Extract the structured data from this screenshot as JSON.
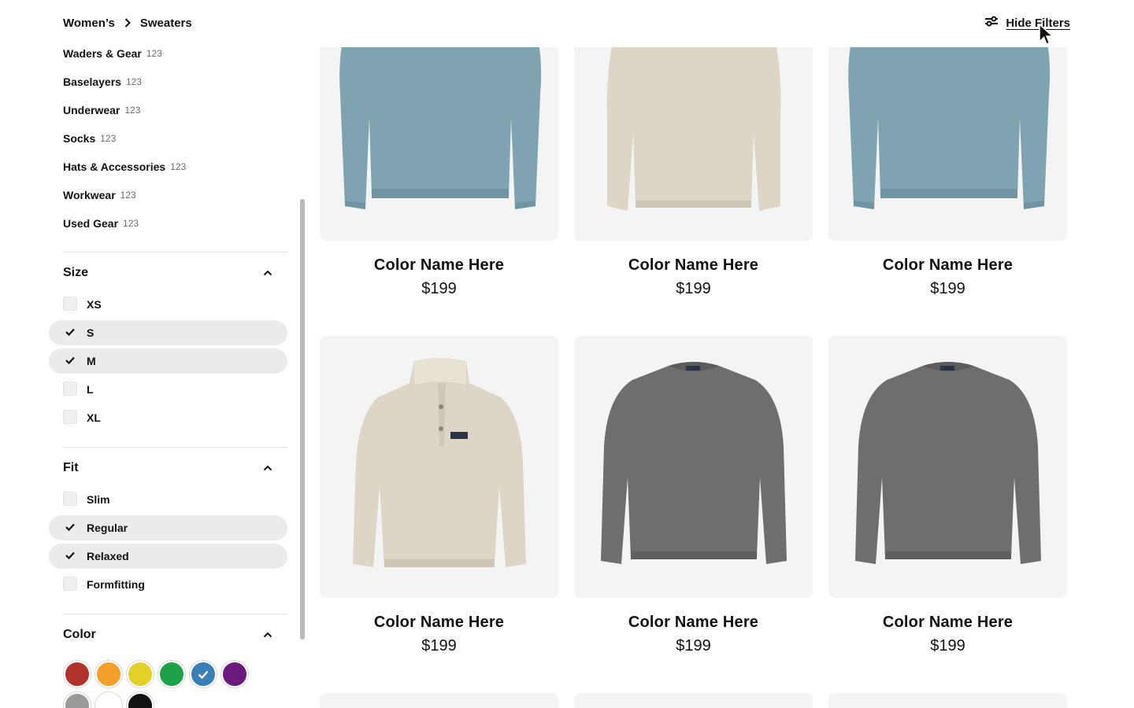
{
  "breadcrumb": {
    "parent": "Women’s",
    "current": "Sweaters"
  },
  "toolbar": {
    "hide_filters_label": "Hide Filters"
  },
  "categories": [
    {
      "label": "Waders & Gear",
      "count": "123"
    },
    {
      "label": "Baselayers",
      "count": "123"
    },
    {
      "label": "Underwear",
      "count": "123"
    },
    {
      "label": "Socks",
      "count": "123"
    },
    {
      "label": "Hats & Accessories",
      "count": "123"
    },
    {
      "label": "Workwear",
      "count": "123"
    },
    {
      "label": "Used Gear",
      "count": "123"
    }
  ],
  "filters": {
    "size": {
      "title": "Size",
      "options": [
        {
          "label": "XS",
          "checked": false
        },
        {
          "label": "S",
          "checked": true
        },
        {
          "label": "M",
          "checked": true
        },
        {
          "label": "L",
          "checked": false
        },
        {
          "label": "XL",
          "checked": false
        }
      ]
    },
    "fit": {
      "title": "Fit",
      "options": [
        {
          "label": "Slim",
          "checked": false
        },
        {
          "label": "Regular",
          "checked": true
        },
        {
          "label": "Relaxed",
          "checked": true
        },
        {
          "label": "Formfitting",
          "checked": false
        }
      ]
    },
    "color": {
      "title": "Color",
      "swatches": [
        {
          "name": "red",
          "hex": "#b0332b",
          "selected": false
        },
        {
          "name": "orange",
          "hex": "#f2a02a",
          "selected": false
        },
        {
          "name": "yellow",
          "hex": "#e3d12a",
          "selected": false
        },
        {
          "name": "green",
          "hex": "#1fa14a",
          "selected": false
        },
        {
          "name": "blue",
          "hex": "#3a7fb6",
          "selected": true
        },
        {
          "name": "purple",
          "hex": "#6a1b7d",
          "selected": false
        },
        {
          "name": "gray",
          "hex": "#9a9a9a",
          "selected": false
        },
        {
          "name": "white",
          "hex": "#ffffff",
          "selected": false
        },
        {
          "name": "black",
          "hex": "#111111",
          "selected": false
        }
      ]
    }
  },
  "products": [
    {
      "name": "Color Name Here",
      "price": "$199",
      "style": "blue-crew"
    },
    {
      "name": "Color Name Here",
      "price": "$199",
      "style": "beige-snap"
    },
    {
      "name": "Color Name Here",
      "price": "$199",
      "style": "blue-crew"
    },
    {
      "name": "Color Name Here",
      "price": "$199",
      "style": "beige-snap"
    },
    {
      "name": "Color Name Here",
      "price": "$199",
      "style": "gray-crew"
    },
    {
      "name": "Color Name Here",
      "price": "$199",
      "style": "gray-crew"
    }
  ],
  "colors": {
    "card_bg": "#f4f4f4",
    "checked_bg": "#ebebeb",
    "blue_sweater": "#7fa3b0",
    "beige_sweater": "#ddd6c6",
    "gray_sweater": "#6e6e6e"
  }
}
